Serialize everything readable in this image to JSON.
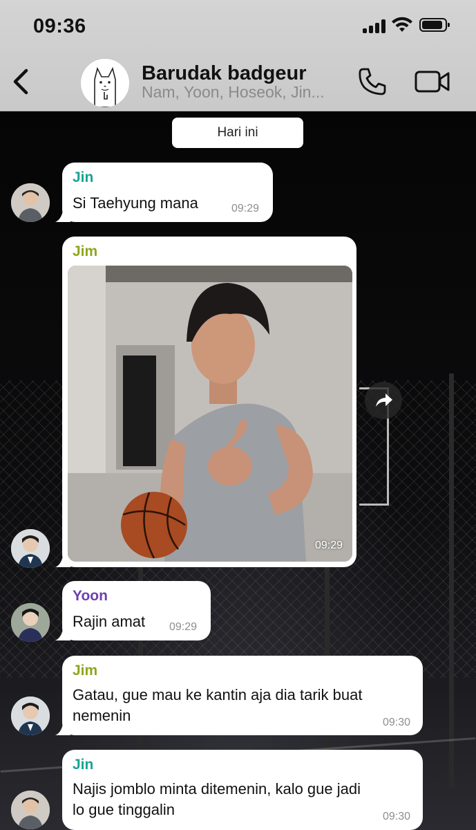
{
  "status_bar": {
    "time": "09:36"
  },
  "header": {
    "title": "Barudak badgeur",
    "members": "Nam, Yoon, Hoseok, Jin..."
  },
  "date_chip": "Hari ini",
  "colors": {
    "jin": "#1aa394",
    "jim": "#8ea61c",
    "yoon": "#6d3fb0",
    "header_bg": "#cfcfcf"
  },
  "messages": [
    {
      "sender": "Jin",
      "text": "Si Taehyung mana",
      "time": "09:29"
    },
    {
      "sender": "Jim",
      "type": "photo",
      "photo_icon": "photo-of-person-with-basketball",
      "time": "09:29"
    },
    {
      "sender": "Yoon",
      "text": "Rajin amat",
      "time": "09:29"
    },
    {
      "sender": "Jim",
      "text_line1": "Gatau, gue mau ke kantin aja dia tarik buat",
      "text_line2": "nemenin",
      "time": "09:30"
    },
    {
      "sender": "Jin",
      "text_line1": "Najis jomblo minta ditemenin, kalo gue jadi",
      "text_line2": "lo gue tinggalin",
      "time": "09:30"
    }
  ]
}
